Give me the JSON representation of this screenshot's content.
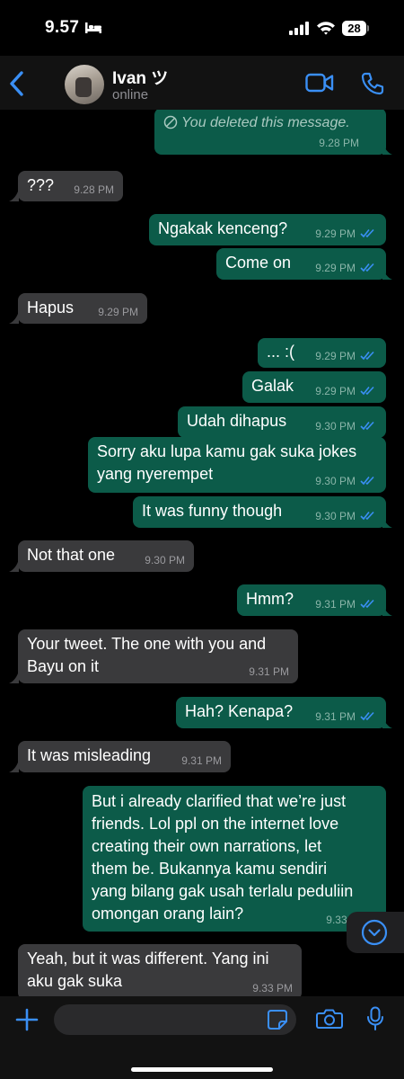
{
  "status_bar": {
    "time": "9.57",
    "battery": "28"
  },
  "header": {
    "contact_name": "Ivan ツ",
    "presence": "online"
  },
  "messages": [
    {
      "dir": "out",
      "text": "You deleted this message.",
      "time": "9.28 PM",
      "deleted": true
    },
    {
      "dir": "in",
      "text": "???",
      "time": "9.28 PM"
    },
    {
      "dir": "out",
      "text": "Ngakak kenceng?",
      "time": "9.29 PM"
    },
    {
      "dir": "out",
      "text": "Come on",
      "time": "9.29 PM"
    },
    {
      "dir": "in",
      "text": "Hapus",
      "time": "9.29 PM"
    },
    {
      "dir": "out",
      "text": "... :(",
      "time": "9.29 PM"
    },
    {
      "dir": "out",
      "text": "Galak",
      "time": "9.29 PM"
    },
    {
      "dir": "out",
      "text": "Udah dihapus",
      "time": "9.30 PM"
    },
    {
      "dir": "out",
      "text": "Sorry aku lupa kamu gak suka jokes\nyang nyerempet",
      "time": "9.30 PM"
    },
    {
      "dir": "out",
      "text": "It was funny though",
      "time": "9.30 PM"
    },
    {
      "dir": "in",
      "text": "Not that one",
      "time": "9.30 PM"
    },
    {
      "dir": "out",
      "text": "Hmm?",
      "time": "9.31 PM"
    },
    {
      "dir": "in",
      "text": "Your tweet. The one with you and\nBayu on it",
      "time": "9.31 PM"
    },
    {
      "dir": "out",
      "text": "Hah? Kenapa?",
      "time": "9.31 PM"
    },
    {
      "dir": "in",
      "text": "It was misleading",
      "time": "9.31 PM"
    },
    {
      "dir": "out",
      "text": "But i already clarified that we’re just\nfriends. Lol ppl on the internet love\ncreating their own narrations, let\nthem be. Bukannya kamu sendiri\nyang bilang gak usah terlalu peduliin\nomongan orang lain?",
      "time": "9.33 PM"
    },
    {
      "dir": "in",
      "text": "Yeah, but it was different. Yang ini\naku gak suka",
      "time": "9.33 PM"
    }
  ],
  "colors": {
    "outgoing": "#0c5b49",
    "incoming": "#3a3a3c",
    "accent": "#3a8ff5"
  },
  "icons": [
    "back-chevron-icon",
    "video-call-icon",
    "phone-icon",
    "plus-icon",
    "sticker-icon",
    "camera-icon",
    "mic-icon",
    "scroll-down-icon",
    "double-check-icon",
    "deleted-icon"
  ]
}
